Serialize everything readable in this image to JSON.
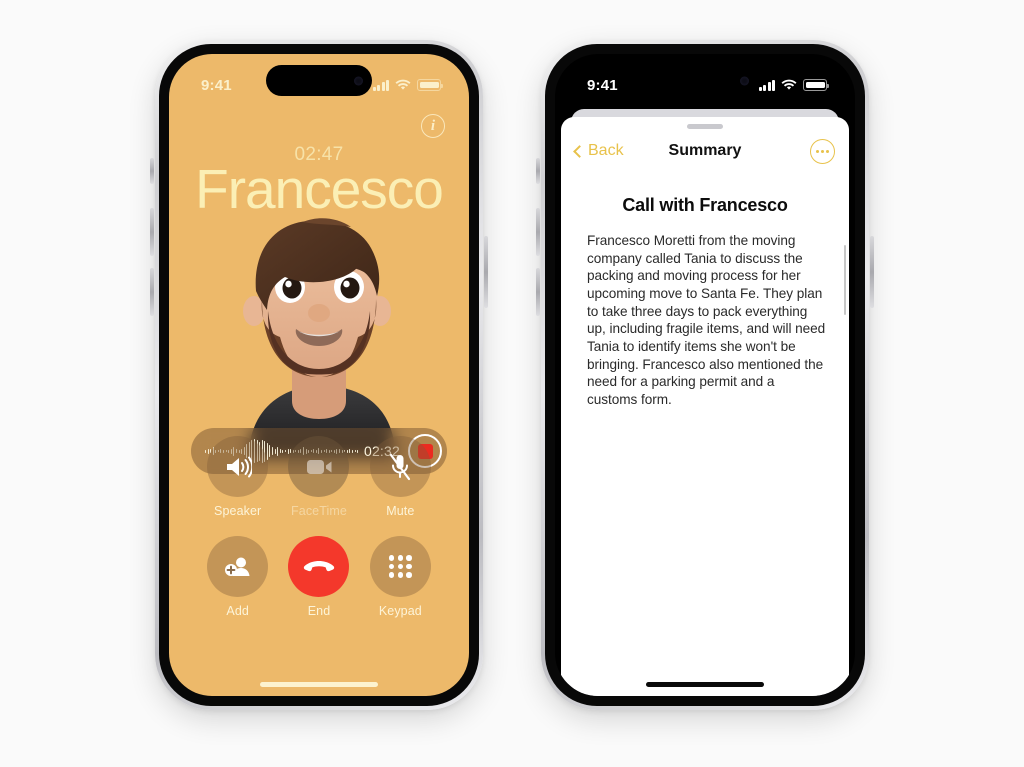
{
  "phones": {
    "call": {
      "status_bar": {
        "time": "9:41",
        "signal_icon": "cellular-bars-icon",
        "wifi_icon": "wifi-icon",
        "battery_icon": "battery-icon"
      },
      "info_button_label": "i",
      "call_timer": "02:47",
      "caller_name": "Francesco",
      "avatar": "memoji-avatar",
      "recording": {
        "elapsed": "02:32",
        "record_button": "stop-recording-button",
        "waveform": [
          3,
          5,
          4,
          8,
          3,
          2,
          4,
          3,
          2,
          3,
          5,
          9,
          4,
          3,
          5,
          8,
          14,
          19,
          22,
          24,
          22,
          19,
          23,
          21,
          17,
          12,
          8,
          5,
          9,
          4,
          3,
          2,
          5,
          4,
          3,
          2,
          3,
          4,
          8,
          5,
          3,
          2,
          4,
          3,
          6,
          3,
          2,
          4,
          3,
          2,
          3,
          5,
          4,
          3,
          2,
          3,
          4,
          3,
          2,
          3
        ]
      },
      "controls": [
        {
          "id": "speaker",
          "label": "Speaker",
          "icon": "speaker-icon",
          "state": "enabled"
        },
        {
          "id": "facetime",
          "label": "FaceTime",
          "icon": "video-camera-icon",
          "state": "disabled"
        },
        {
          "id": "mute",
          "label": "Mute",
          "icon": "microphone-muted-icon",
          "state": "enabled"
        },
        {
          "id": "add",
          "label": "Add",
          "icon": "add-person-icon",
          "state": "enabled"
        },
        {
          "id": "end",
          "label": "End",
          "icon": "end-call-icon",
          "state": "destructive"
        },
        {
          "id": "keypad",
          "label": "Keypad",
          "icon": "keypad-icon",
          "state": "enabled"
        }
      ],
      "colors": {
        "background": "#EDB96A",
        "name_text": "#FBEFB5",
        "end_button": "#F4382B",
        "record_dot": "#EB2B20"
      }
    },
    "summary": {
      "status_bar": {
        "time": "9:41",
        "signal_icon": "cellular-bars-icon",
        "wifi_icon": "wifi-icon",
        "battery_icon": "battery-icon"
      },
      "nav": {
        "back_label": "Back",
        "title": "Summary",
        "more_label": "more-options"
      },
      "heading": "Call with Francesco",
      "body": "Francesco Moretti from the moving company called Tania to discuss the packing and moving process for her upcoming move to Santa Fe. They plan to take three days to pack everything up, including fragile items, and will need Tania to identify items she won't be bringing. Francesco also mentioned the need for a parking permit and a customs form.",
      "colors": {
        "accent": "#E8C24B",
        "sheet": "#FFFFFF",
        "text": "#2A2A2A"
      }
    }
  }
}
